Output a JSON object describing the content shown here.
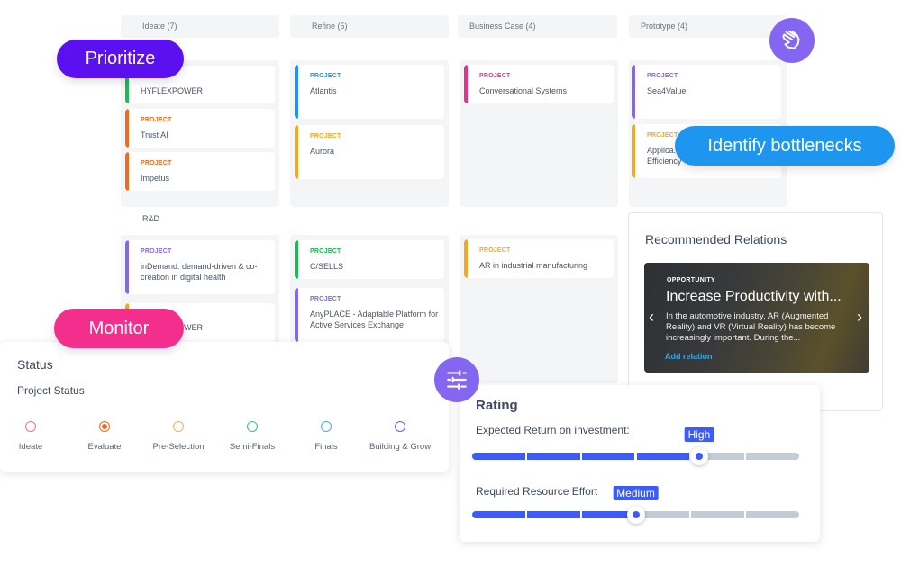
{
  "board": {
    "columns": [
      {
        "header": "Ideate (7)"
      },
      {
        "header": "Refine (5)"
      },
      {
        "header": "Business Case (4)"
      },
      {
        "header": "Prototype (4)"
      }
    ],
    "lane_label": "R&D",
    "cards": [
      {
        "kind": "PROJECT",
        "title": "HYFLEXPOWER",
        "color": "#1db954"
      },
      {
        "kind": "PROJECT",
        "title": "Trust AI",
        "color": "#f26a1b"
      },
      {
        "kind": "PROJECT",
        "title": "Impetus",
        "color": "#f26a1b"
      },
      {
        "kind": "PROJECT",
        "title": "Atlantis",
        "color": "#1e96f0"
      },
      {
        "kind": "PROJECT",
        "title": "Aurora",
        "color": "#f5a623"
      },
      {
        "kind": "PROJECT",
        "title": "Conversational Systems",
        "color": "#ec2f8c"
      },
      {
        "kind": "PROJECT",
        "title": "Sea4Value",
        "color": "#8466f0"
      },
      {
        "kind": "PROJECT",
        "title": "Applica... Efficiency",
        "color": "#f5a623"
      },
      {
        "kind": "PROJECT",
        "title": "inDemand: demand-driven & co-creation in digital health",
        "color": "#8466f0"
      },
      {
        "kind": "PROJECT",
        "title": "HYFLEXPOWER",
        "color": "#f5a623"
      },
      {
        "kind": "PROJECT",
        "title": "C/SELLS",
        "color": "#1db954"
      },
      {
        "kind": "PROJECT",
        "title": "AnyPLACE - Adaptable Platform for Active Services Exchange",
        "color": "#8466f0"
      },
      {
        "kind": "PROJECT",
        "title": "AR in industrial manufacturing",
        "color": "#f5a623"
      }
    ]
  },
  "callouts": {
    "prioritize": "Prioritize",
    "identify": "Identify bottlenecks",
    "monitor": "Monitor"
  },
  "icons": {
    "hand": "hand-pointer-icon",
    "sliders": "sliders-icon"
  },
  "recommended": {
    "title": "Recommended Relations",
    "kind": "OPPORTUNITY",
    "headline": "Increase Productivity with...",
    "description": "In the automotive industry, AR (Augmented Reality) and VR (Virtual Reality) has become increasingly important. During the...",
    "action": "Add relation",
    "prev": "‹",
    "next": "›"
  },
  "status": {
    "title": "Status",
    "subtitle": "Project Status",
    "selected": "Evaluate",
    "options": [
      {
        "label": "Ideate",
        "color": "#f07878"
      },
      {
        "label": "Evaluate",
        "color": "#f26a1b"
      },
      {
        "label": "Pre-Selection",
        "color": "#f5b056"
      },
      {
        "label": "Semi-Finals",
        "color": "#3fbf7f"
      },
      {
        "label": "Finals",
        "color": "#4aa8f0"
      },
      {
        "label": "Building & Grow",
        "color": "#7558e8"
      }
    ]
  },
  "rating": {
    "title": "Rating",
    "roi": {
      "label": "Expected Return on investment:",
      "value": "High",
      "segments": 6,
      "level_fraction": 0.694
    },
    "effort": {
      "label": "Required Resource Effort",
      "value": "Medium",
      "segments": 6,
      "level_fraction": 0.5
    }
  },
  "colors": {
    "accent_blue": "#3c5cf5",
    "prioritize": "#5b10f0",
    "identify": "#1e96f0",
    "monitor": "#f42e8c",
    "icon_purple": "#8466f0"
  }
}
